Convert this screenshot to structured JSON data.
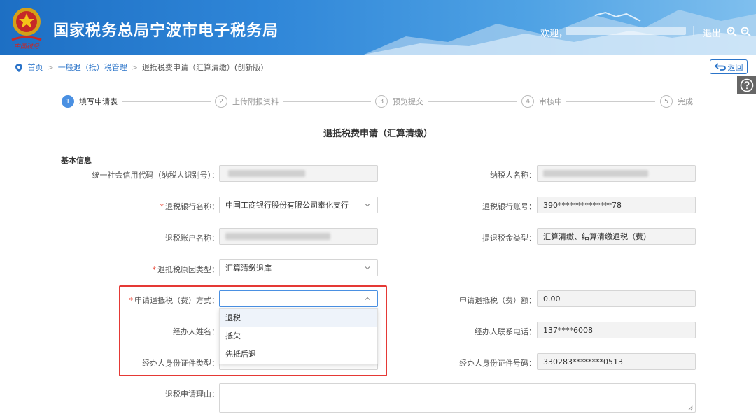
{
  "header": {
    "title": "国家税务总局宁波市电子税务局",
    "logo_text": "中国税务",
    "welcome": "欢迎，",
    "separator": "|",
    "logout": "退出"
  },
  "breadcrumb": {
    "home": "首页",
    "level1": "一般退（抵）税管理",
    "current": "退抵税费申请（汇算清缴）(创新版)",
    "back": "返回"
  },
  "steps": [
    {
      "num": "1",
      "label": "填写申请表"
    },
    {
      "num": "2",
      "label": "上传附报资料"
    },
    {
      "num": "3",
      "label": "预览提交"
    },
    {
      "num": "4",
      "label": "审核中"
    },
    {
      "num": "5",
      "label": "完成"
    }
  ],
  "form": {
    "title": "退抵税费申请（汇算清缴）",
    "section": "基本信息",
    "required_mark": "*",
    "credit_code_label": "统一社会信用代码（纳税人识别号）：",
    "taxpayer_name_label": "纳税人名称：",
    "bank_name_label": "退税银行名称：",
    "bank_name_value": "中国工商银行股份有限公司奉化支行",
    "bank_account_label": "退税银行账号：",
    "bank_account_value": "390**************78",
    "account_name_label": "退税账户名称：",
    "amount_type_label": "提退税金类型：",
    "amount_type_value": "汇算清缴、结算清缴退税（费）",
    "reason_type_label": "退抵税原因类型：",
    "reason_type_value": "汇算清缴退库",
    "method_label": "申请退抵税（费）方式：",
    "method_value": "",
    "apply_amount_label": "申请退抵税（费）额：",
    "apply_amount_value": "0.00",
    "agent_name_label": "经办人姓名：",
    "agent_phone_label": "经办人联系电话：",
    "agent_phone_value": "137****6008",
    "agent_id_type_label": "经办人身份证件类型：",
    "agent_id_no_label": "经办人身份证件号码：",
    "agent_id_no_value": "330283********0513",
    "reason_label": "退税申请理由：",
    "reason_value": ""
  },
  "dropdown": {
    "options": [
      "退税",
      "抵欠",
      "先抵后退"
    ],
    "highlighted": "退税"
  },
  "colors": {
    "header_blue": "#2f86d8",
    "link_blue": "#2b74c9",
    "step_active": "#4a90e2",
    "required_red": "#e84c3d",
    "annotation_red": "#e53935"
  },
  "icons": [
    "location-pin-icon",
    "back-arrow-icon",
    "help-icon",
    "zoom-in-icon",
    "zoom-out-icon",
    "chevron-down-icon",
    "chevron-up-icon",
    "tax-emblem-logo"
  ]
}
